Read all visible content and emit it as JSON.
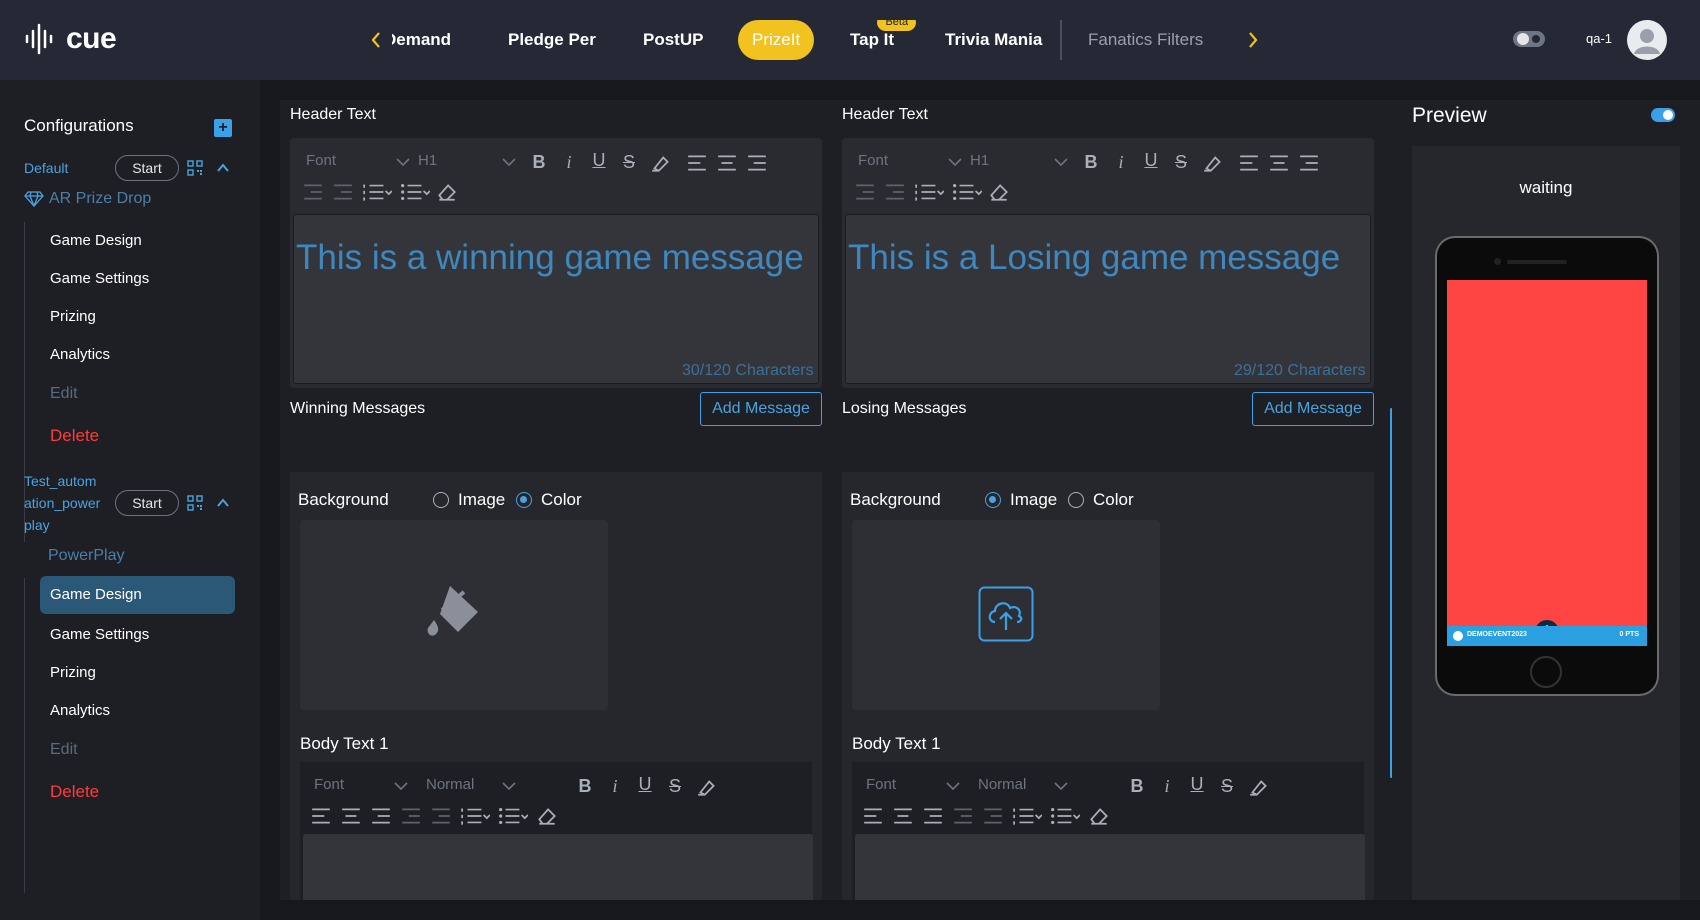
{
  "app": {
    "logo_text": "cue"
  },
  "nav": {
    "tabs": [
      {
        "label": "Demand",
        "state": "partial"
      },
      {
        "label": "Pledge Per",
        "state": "normal"
      },
      {
        "label": "PostUP",
        "state": "normal"
      },
      {
        "label": "PrizeIt",
        "state": "active"
      },
      {
        "label": "Tap It",
        "state": "normal",
        "badge": "Beta"
      },
      {
        "label": "Trivia Mania",
        "state": "normal"
      },
      {
        "label": "Fanatics Filters",
        "state": "dim"
      }
    ],
    "user": "qa-1",
    "accent": "#f2c21f"
  },
  "sidebar": {
    "title": "Configurations",
    "groups": [
      {
        "name": "Default",
        "start_label": "Start",
        "subtitle": "AR Prize Drop",
        "items": [
          "Game Design",
          "Game Settings",
          "Prizing",
          "Analytics",
          "Edit",
          "Delete"
        ]
      },
      {
        "name_lines": [
          "Test_autom",
          "ation_power",
          "play"
        ],
        "start_label": "Start",
        "subtitle": "PowerPlay",
        "items": [
          "Game Design",
          "Game Settings",
          "Prizing",
          "Analytics",
          "Edit",
          "Delete"
        ],
        "active_item": "Game Design"
      }
    ]
  },
  "editors": {
    "left": {
      "header_label": "Header Text",
      "font_placeholder": "Font",
      "size_value": "H1",
      "message": "This is a winning game message",
      "char_count": "30/120 Characters",
      "messages_label": "Winning Messages",
      "add_label": "Add Message",
      "background_label": "Background",
      "bg_options": [
        "Image",
        "Color"
      ],
      "bg_selected": "Color",
      "body_label": "Body Text 1",
      "body_font": "Font",
      "body_size": "Normal"
    },
    "right": {
      "header_label": "Header Text",
      "font_placeholder": "Font",
      "size_value": "H1",
      "message": "This is a Losing game message",
      "char_count": "29/120 Characters",
      "messages_label": "Losing Messages",
      "add_label": "Add Message",
      "background_label": "Background",
      "bg_options": [
        "Image",
        "Color"
      ],
      "bg_selected": "Image",
      "body_label": "Body Text 1",
      "body_font": "Font",
      "body_size": "Normal"
    }
  },
  "preview": {
    "title": "Preview",
    "status": "waiting",
    "screen_color": "#ff4444",
    "footer_left": "DEMOEVENT2023",
    "footer_right": "0 PTS"
  }
}
